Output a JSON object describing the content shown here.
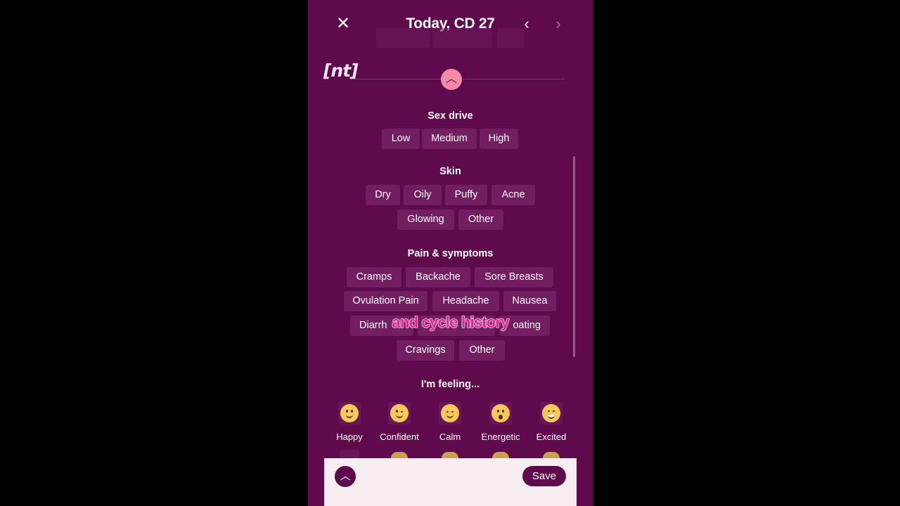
{
  "header": {
    "title": "Today, CD 27",
    "close_icon": "close-icon",
    "prev_icon": "chevron-left-icon",
    "next_icon": "chevron-right-icon"
  },
  "logo": {
    "text": "[nt]"
  },
  "sections": {
    "sex_drive": {
      "title": "Sex drive",
      "options": [
        "Low",
        "Medium",
        "High"
      ]
    },
    "skin": {
      "title": "Skin",
      "options": [
        "Dry",
        "Oily",
        "Puffy",
        "Acne",
        "Glowing",
        "Other"
      ]
    },
    "pain": {
      "title": "Pain & symptoms",
      "options": [
        "Cramps",
        "Backache",
        "Sore Breasts",
        "Ovulation Pain",
        "Headache",
        "Nausea",
        "Diarrh",
        "oating",
        "Cravings",
        "Other"
      ]
    },
    "feeling": {
      "title": "I'm feeling...",
      "options": [
        "Happy",
        "Confident",
        "Calm",
        "Energetic",
        "Excited"
      ]
    }
  },
  "caption": "and cycle history",
  "footer": {
    "save_label": "Save",
    "up_icon": "chevron-up-icon"
  },
  "colors": {
    "background": "#5e0a4d",
    "chip": "#731d62",
    "accent": "#f28aa8",
    "caption": "#e41e98"
  }
}
